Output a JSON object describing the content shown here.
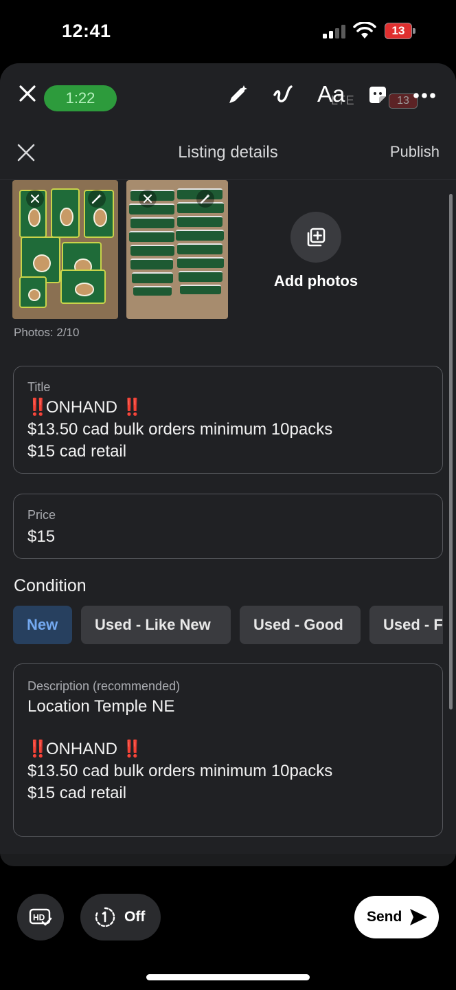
{
  "status_bar": {
    "time": "12:41",
    "battery": "13",
    "icons": [
      "signal-icon",
      "wifi-icon",
      "battery-icon"
    ]
  },
  "story_toolbar": {
    "timer": "1:22",
    "text_tool": "Aa",
    "ghost_network": "LTE",
    "ghost_battery": "13",
    "icons": [
      "close-icon",
      "pen-sparkle-icon",
      "squiggle-icon",
      "sticker-icon",
      "more-icon"
    ],
    "timer_color": "#2d9b3c"
  },
  "listing": {
    "header_title": "Listing details",
    "publish_label": "Publish",
    "add_photos_label": "Add photos",
    "photo_count": "Photos: 2/10",
    "title_label": "Title",
    "title_line1": "ONHAND",
    "title_line2": "$13.50 cad bulk orders minimum 10packs",
    "title_line3": "$15 cad retail",
    "bang_emoji": "‼️",
    "price_label": "Price",
    "price_value": "$15",
    "condition_heading": "Condition",
    "conditions": [
      "New",
      "Used - Like New",
      "Used - Good",
      "Used - Fair"
    ],
    "selected_condition": "New",
    "description_label": "Description (recommended)",
    "description_line1": "Location Temple NE",
    "description_line2": "ONHAND",
    "description_line3": "$13.50 cad bulk orders minimum 10packs",
    "description_line4": "$15 cad retail",
    "accent_color": "#74a9f0"
  },
  "bottom_bar": {
    "hd_icon": "hd-check-icon",
    "timer_label": "Off",
    "send_label": "Send"
  }
}
